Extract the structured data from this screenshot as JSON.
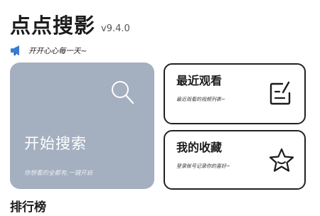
{
  "header": {
    "title": "点点搜影",
    "version": "v9.4.0",
    "slogan_icon": "megaphone-icon",
    "slogan": "开开心心每一天~"
  },
  "search_card": {
    "title": "开始搜索",
    "subtitle": "你想看的全都有,一键开启",
    "icon": "search-icon",
    "background": "#a4afbf"
  },
  "recent_card": {
    "title": "最近观看",
    "subtitle": "最近观看的视频列表~",
    "icon": "edit-note-icon"
  },
  "favorites_card": {
    "title": "我的收藏",
    "subtitle": "登录账号记录你的喜好~",
    "icon": "star-smile-icon"
  },
  "section": {
    "title": "排行榜"
  },
  "colors": {
    "accent_blue": "#3a7bd5",
    "card_border": "#222222"
  }
}
